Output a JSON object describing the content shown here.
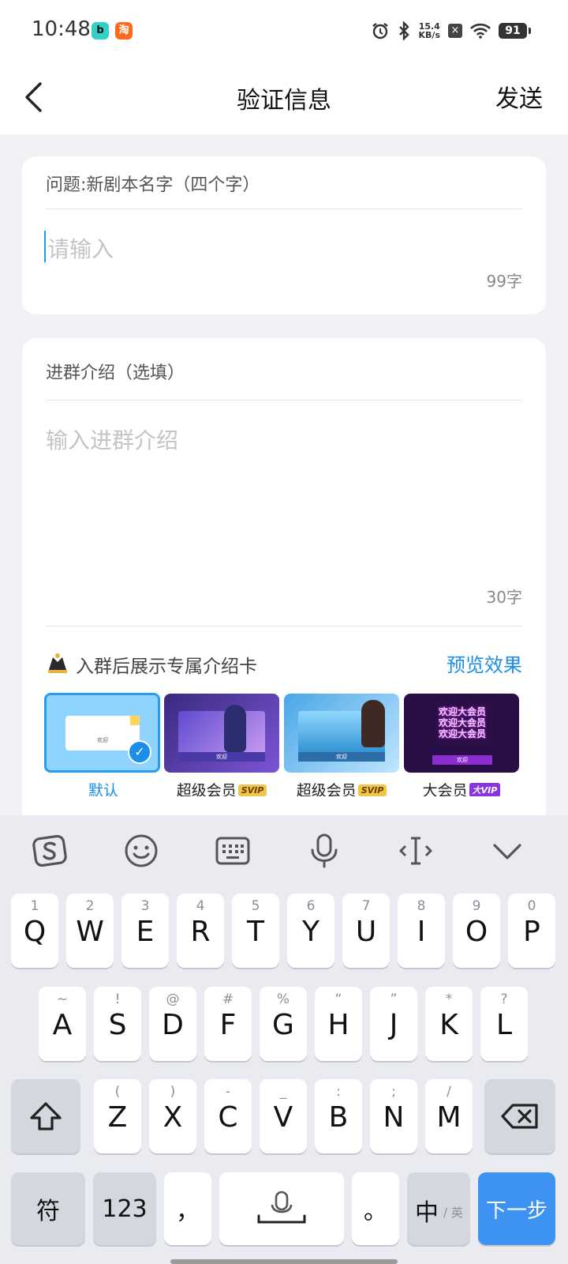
{
  "status_bar": {
    "time": "10:48",
    "app_icon_1": "b",
    "app_icon_2": "淘",
    "speed_value": "15.4",
    "speed_unit": "KB/s",
    "battery": "91"
  },
  "header": {
    "title": "验证信息",
    "send_label": "发送"
  },
  "question_card": {
    "question": "问题:新剧本名字（四个字）",
    "placeholder": "请输入",
    "counter": "99字"
  },
  "intro_card": {
    "label": "进群介绍（选填）",
    "placeholder": "输入进群介绍",
    "counter": "30字",
    "feature_label": "入群后展示专属介绍卡",
    "preview_label": "预览效果",
    "cards": [
      {
        "caption": "默认",
        "badge": "",
        "selected": true,
        "thumb_text": "欢迎"
      },
      {
        "caption": "超级会员",
        "badge": "SVIP",
        "thumb_text": "欢迎"
      },
      {
        "caption": "超级会员",
        "badge": "SVIP",
        "thumb_text": "欢迎"
      },
      {
        "caption": "大会员",
        "badge": "大VIP",
        "thumb_text": "欢迎",
        "headline": [
          "欢迎大会员",
          "欢迎大会员",
          "欢迎大会员"
        ]
      }
    ]
  },
  "keyboard": {
    "row1": [
      {
        "sub": "1",
        "main": "Q"
      },
      {
        "sub": "2",
        "main": "W"
      },
      {
        "sub": "3",
        "main": "E"
      },
      {
        "sub": "4",
        "main": "R"
      },
      {
        "sub": "5",
        "main": "T"
      },
      {
        "sub": "6",
        "main": "Y"
      },
      {
        "sub": "7",
        "main": "U"
      },
      {
        "sub": "8",
        "main": "I"
      },
      {
        "sub": "9",
        "main": "O"
      },
      {
        "sub": "0",
        "main": "P"
      }
    ],
    "row2": [
      {
        "sub": "~",
        "main": "A"
      },
      {
        "sub": "!",
        "main": "S"
      },
      {
        "sub": "@",
        "main": "D"
      },
      {
        "sub": "#",
        "main": "F"
      },
      {
        "sub": "%",
        "main": "G"
      },
      {
        "sub": "“",
        "main": "H"
      },
      {
        "sub": "”",
        "main": "J"
      },
      {
        "sub": "*",
        "main": "K"
      },
      {
        "sub": "?",
        "main": "L"
      }
    ],
    "row3": [
      {
        "sub": "(",
        "main": "Z"
      },
      {
        "sub": ")",
        "main": "X"
      },
      {
        "sub": "-",
        "main": "C"
      },
      {
        "sub": "_",
        "main": "V"
      },
      {
        "sub": ":",
        "main": "B"
      },
      {
        "sub": ";",
        "main": "N"
      },
      {
        "sub": "/",
        "main": "M"
      }
    ],
    "symbol_key": "符",
    "num_key": "123",
    "comma_key": "，",
    "period_key": "。",
    "lang_key_main": "中",
    "lang_key_sub": "/ 英",
    "next_key": "下一步"
  },
  "colors": {
    "accent": "#1a8ee8",
    "next_key": "#3e92f2",
    "page_bg": "#f2f2f6"
  }
}
